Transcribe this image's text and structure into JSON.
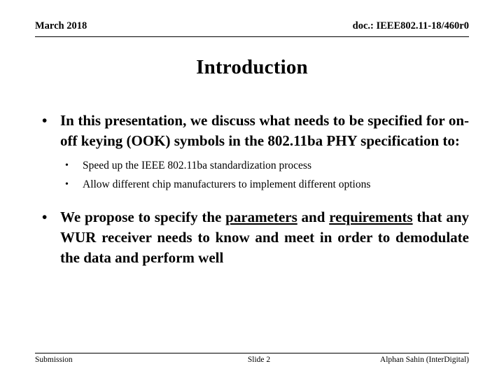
{
  "header": {
    "date": "March 2018",
    "doc_id": "doc.: IEEE802.11-18/460r0"
  },
  "title": "Introduction",
  "content": {
    "bullet_1": {
      "marker": "•",
      "text": "In this presentation, we discuss what needs to be specified for on-off keying (OOK) symbols in the 802.11ba PHY specification to:"
    },
    "sub_bullets": [
      {
        "marker": "•",
        "text": "Speed up the IEEE 802.11ba standardization process"
      },
      {
        "marker": "•",
        "text": "Allow different chip manufacturers to implement different options"
      }
    ],
    "bullet_2": {
      "marker": "•",
      "text_before": "We propose to specify the ",
      "emphasis_1": "parameters",
      "text_middle": " and ",
      "emphasis_2": "requirements",
      "text_after": " that any WUR receiver needs to know and meet in order to demodulate the data and perform well"
    }
  },
  "footer": {
    "left": "Submission",
    "center": "Slide 2",
    "right": "Alphan Sahin (InterDigital)"
  }
}
